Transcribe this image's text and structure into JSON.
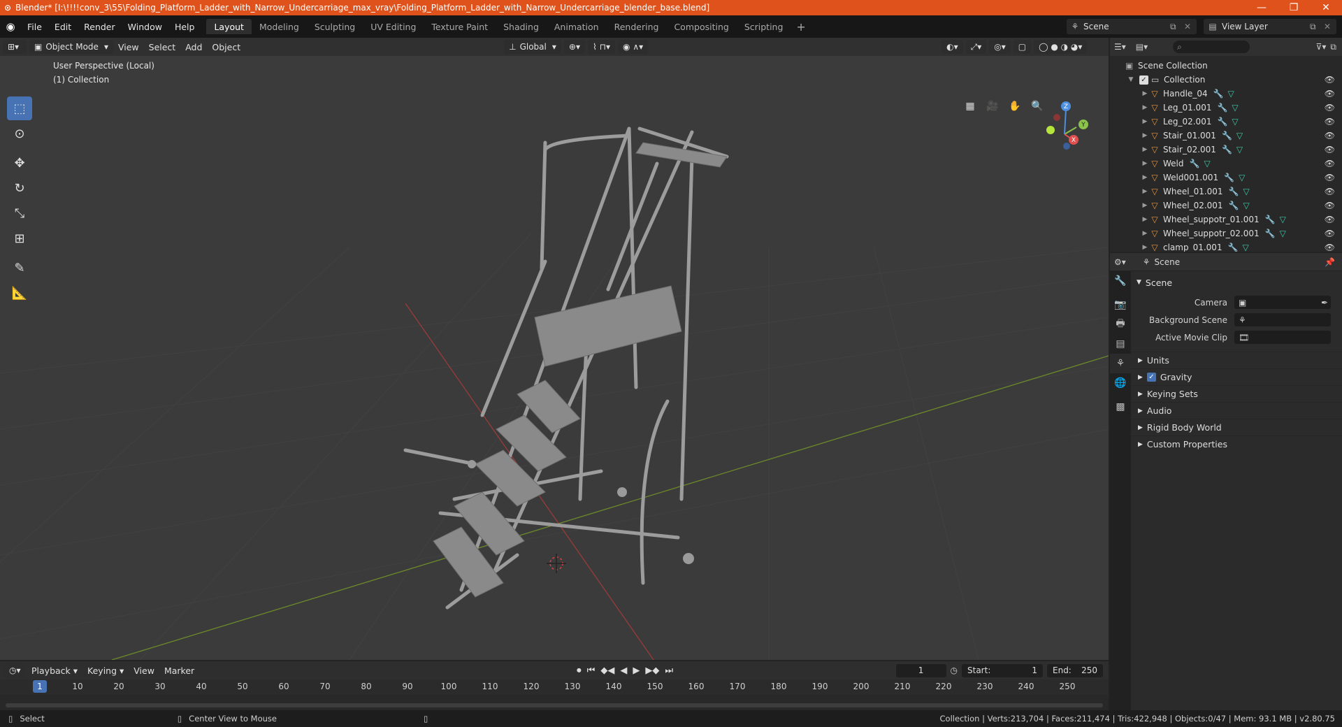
{
  "window": {
    "title": "Blender* [I:\\!!!!conv_3\\55\\Folding_Platform_Ladder_with_Narrow_Undercarriage_max_vray\\Folding_Platform_Ladder_with_Narrow_Undercarriage_blender_base.blend]",
    "minimize": "—",
    "maximize": "❐",
    "close": "✕"
  },
  "menubar": {
    "items": [
      "File",
      "Edit",
      "Render",
      "Window",
      "Help"
    ],
    "workspaces": [
      "Layout",
      "Modeling",
      "Sculpting",
      "UV Editing",
      "Texture Paint",
      "Shading",
      "Animation",
      "Rendering",
      "Compositing",
      "Scripting"
    ],
    "active_workspace": "Layout",
    "add_workspace": "+",
    "scene_label": "Scene",
    "view_layer_label": "View Layer"
  },
  "viewport": {
    "mode": "Object Mode",
    "menus": [
      "View",
      "Select",
      "Add",
      "Object"
    ],
    "transform_orientation": "Global",
    "info_line1": "User Perspective (Local)",
    "info_line2": "(1) Collection",
    "gizmo_axes": {
      "x": "X",
      "y": "Y",
      "z": "Z"
    }
  },
  "outliner": {
    "scene_collection": "Scene Collection",
    "collection": "Collection",
    "objects": [
      "Handle_04",
      "Leg_01.001",
      "Leg_02.001",
      "Stair_01.001",
      "Stair_02.001",
      "Weld",
      "Weld001.001",
      "Wheel_01.001",
      "Wheel_02.001",
      "Wheel_suppotr_01.001",
      "Wheel_suppotr_02.001",
      "clamp_01.001"
    ]
  },
  "properties": {
    "header": "Scene",
    "panel": "Scene",
    "camera_label": "Camera",
    "background_scene_label": "Background Scene",
    "active_movie_clip_label": "Active Movie Clip",
    "sub_panels": [
      "Units",
      "Gravity",
      "Keying Sets",
      "Audio",
      "Rigid Body World",
      "Custom Properties"
    ],
    "gravity_checked": true
  },
  "timeline": {
    "menus": [
      "Playback",
      "Keying",
      "View",
      "Marker"
    ],
    "current_frame": "1",
    "start_label": "Start:",
    "start": "1",
    "end_label": "End:",
    "end": "250",
    "ruler": [
      "1",
      "10",
      "20",
      "30",
      "40",
      "50",
      "60",
      "70",
      "80",
      "90",
      "100",
      "110",
      "120",
      "130",
      "140",
      "150",
      "160",
      "170",
      "180",
      "190",
      "200",
      "210",
      "220",
      "230",
      "240",
      "250"
    ]
  },
  "statusbar": {
    "select": "Select",
    "center_view": "Center View to Mouse",
    "stats": "Collection | Verts:213,704 | Faces:211,474 | Tris:422,948 | Objects:0/47 | Mem: 93.1 MB | v2.80.75"
  },
  "colors": {
    "title_bar": "#e0521b",
    "accent": "#4772b3",
    "object_icon": "#e6953b",
    "mesh_icon": "#3ec9a7"
  }
}
